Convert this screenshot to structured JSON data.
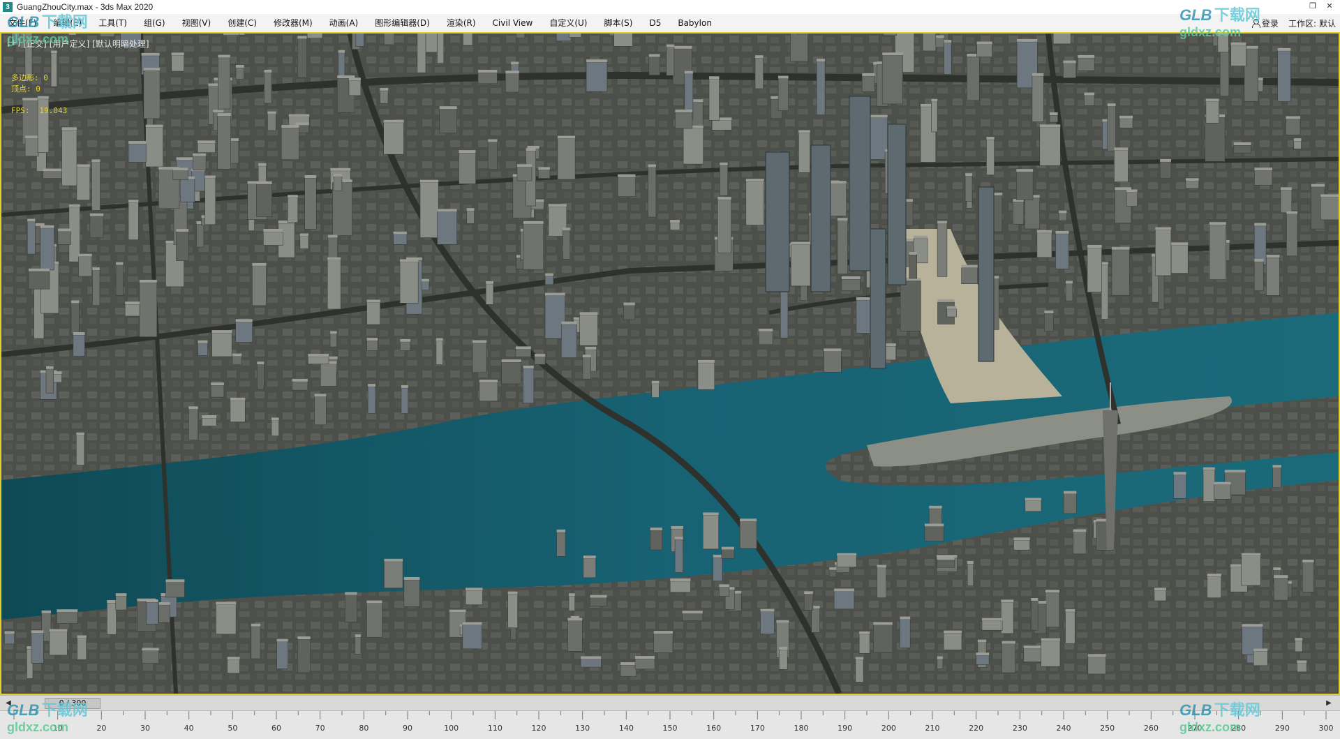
{
  "titlebar": {
    "title": "GuangZhouCity.max - 3ds Max 2020",
    "app_icon_glyph": "3"
  },
  "menu": {
    "items": [
      "文件(F)",
      "编辑(E)",
      "工具(T)",
      "组(G)",
      "视图(V)",
      "创建(C)",
      "修改器(M)",
      "动画(A)",
      "图形编辑器(D)",
      "渲染(R)",
      "Civil View",
      "自定义(U)",
      "脚本(S)",
      "D5",
      "Babylon"
    ],
    "login_label": "登录",
    "workspace_label": "工作区:",
    "workspace_value": "默认"
  },
  "viewport": {
    "label_plus": "[+]",
    "label_view": "[正交]",
    "label_shading": "[用户定义]",
    "label_material": "[默认明暗处理]",
    "stats_polys_label": "多边形:",
    "stats_polys_value": "0",
    "stats_verts_label": "顶点:",
    "stats_verts_value": "0",
    "fps_label": "FPS:",
    "fps_value": "19.043"
  },
  "timebar": {
    "frame_readout": "0 / 300"
  },
  "timeline": {
    "ticks": [
      "10",
      "20",
      "30",
      "40",
      "50",
      "60",
      "70",
      "80",
      "90",
      "100",
      "110",
      "120",
      "130",
      "140",
      "150",
      "160",
      "170",
      "180",
      "190",
      "200",
      "210",
      "220",
      "230",
      "240",
      "250",
      "260",
      "270",
      "280",
      "290",
      "300"
    ]
  },
  "watermarks": {
    "logo_text": "GLB",
    "site_cn": "下载网",
    "site_url": "gldxz.com"
  },
  "colors": {
    "viewport_border": "#e2cf2a",
    "stats_text": "#e4d23a",
    "river": "#155866",
    "ground": "#4a4d47"
  }
}
